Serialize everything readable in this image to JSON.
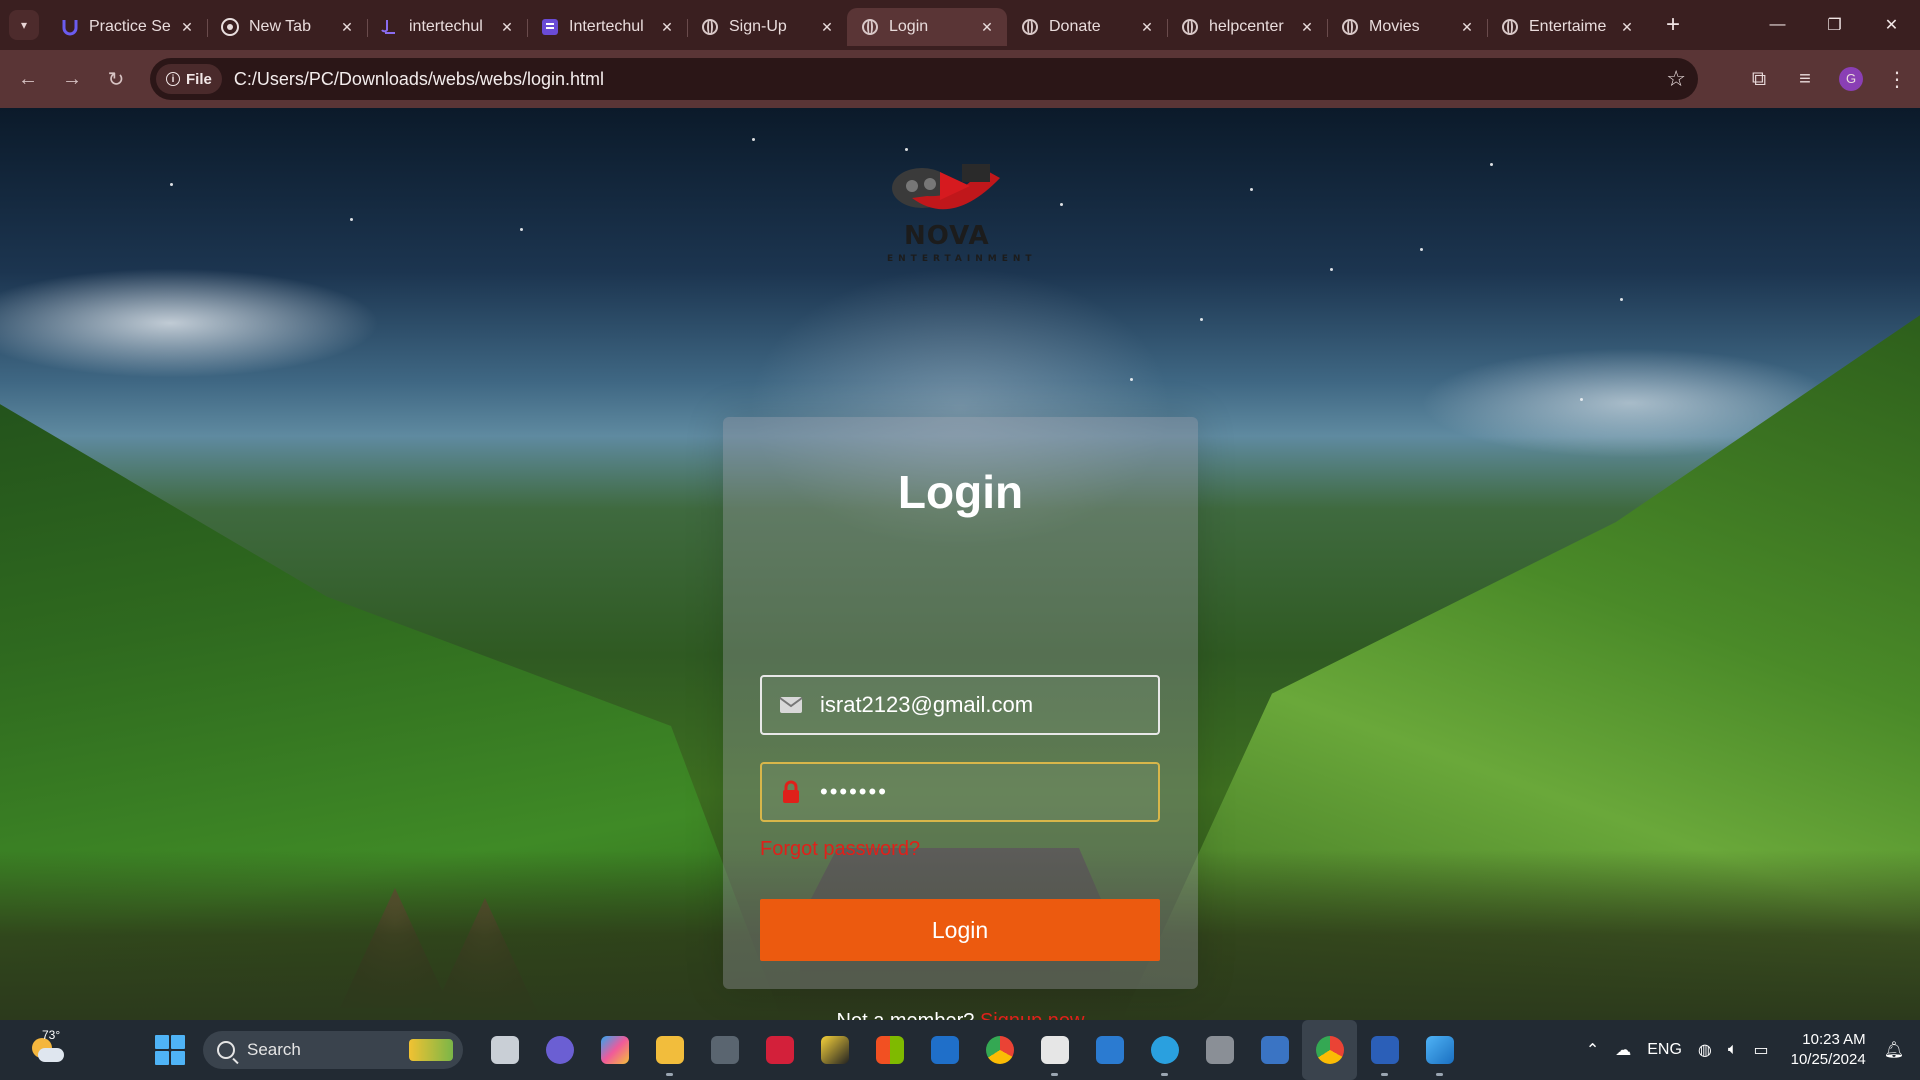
{
  "browser": {
    "tabs": [
      {
        "title": "Practice Se",
        "icon": "u-brand-icon",
        "active": false
      },
      {
        "title": "New Tab",
        "icon": "chrome-icon",
        "active": false
      },
      {
        "title": "intertechul",
        "icon": "intertech-icon",
        "active": false
      },
      {
        "title": "Intertechul",
        "icon": "intertech-doc-icon",
        "active": false
      },
      {
        "title": "Sign-Up",
        "icon": "globe-icon",
        "active": false
      },
      {
        "title": "Login",
        "icon": "globe-icon",
        "active": true
      },
      {
        "title": "Donate",
        "icon": "globe-icon",
        "active": false
      },
      {
        "title": "helpcenter",
        "icon": "globe-icon",
        "active": false
      },
      {
        "title": "Movies",
        "icon": "globe-icon",
        "active": false
      },
      {
        "title": "Entertaime",
        "icon": "globe-icon",
        "active": false
      }
    ],
    "site_chip": "File",
    "url": "C:/Users/PC/Downloads/webs/webs/login.html",
    "profile_initial": "G"
  },
  "logo": {
    "name": "NOVA",
    "tagline": "ENTERTAINMENT"
  },
  "login": {
    "title": "Login",
    "email_value": "israt2123@gmail.com",
    "password_value": "•••••••",
    "forgot_label": "Forgot password?",
    "button_label": "Login",
    "member_prompt": "Not a member?",
    "signup_label": "Signup now"
  },
  "taskbar": {
    "temperature": "73°",
    "search_label": "Search",
    "language": "ENG",
    "time": "10:23 AM",
    "date": "10/25/2024"
  },
  "colors": {
    "accent_button": "#ec5a0f",
    "link_red": "#e0201a",
    "tab_bar": "#3a1f20",
    "toolbar": "#5a3536"
  }
}
